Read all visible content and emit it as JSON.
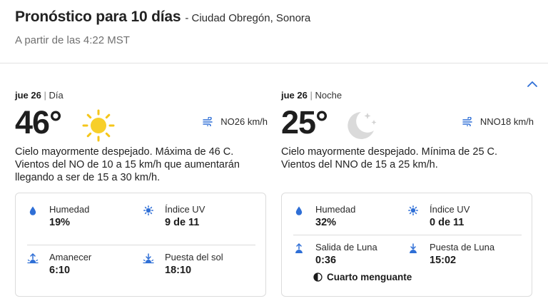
{
  "header": {
    "title": "Pronóstico para 10 días",
    "location": "- Ciudad Obregón, Sonora",
    "as_of": "A partir de las 4:22 MST"
  },
  "colors": {
    "accent": "#2f6fd6",
    "sun": "#f5c61a",
    "moon": "#d9d9d9",
    "border": "#dcdcdc"
  },
  "day": {
    "date": "jue 26",
    "separator": "|",
    "period": "Día",
    "temp": "46°",
    "icon": "sun-icon",
    "wind": "NO26 km/h",
    "description": "Cielo mayormente despejado. Máxima de 46 C. Vientos del NO de 10 a 15 km/h que aumentarán llegando a ser de 15 a 30 km/h.",
    "details": {
      "humidity_label": "Humedad",
      "humidity_value": "19%",
      "uv_label": "Índice UV",
      "uv_value": "9 de 11",
      "sunrise_label": "Amanecer",
      "sunrise_value": "6:10",
      "sunset_label": "Puesta del sol",
      "sunset_value": "18:10"
    }
  },
  "night": {
    "date": "jue 26",
    "separator": "|",
    "period": "Noche",
    "temp": "25°",
    "icon": "moon-stars-icon",
    "wind": "NNO18 km/h",
    "description": "Cielo mayormente despejado. Mínima de 25 C. Vientos del NNO de 15 a 25 km/h.",
    "details": {
      "humidity_label": "Humedad",
      "humidity_value": "32%",
      "uv_label": "Índice UV",
      "uv_value": "0 de 11",
      "moonrise_label": "Salida de Luna",
      "moonrise_value": "0:36",
      "moonset_label": "Puesta de Luna",
      "moonset_value": "15:02",
      "moon_phase": "Cuarto menguante"
    }
  }
}
